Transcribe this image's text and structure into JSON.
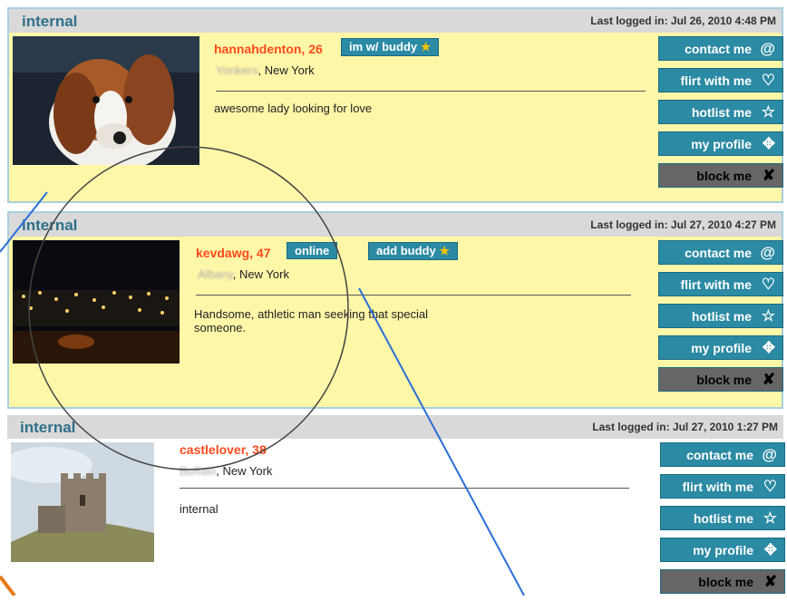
{
  "cards": [
    {
      "tag": "internal",
      "last_login": "Last logged in: Jul 26, 2010 4:48 PM",
      "name": "hannahdenton, 26",
      "location_hidden": "Yonkers",
      "location": ", New York",
      "description": "awesome lady looking for love",
      "badges": [
        {
          "label": "im w/ buddy",
          "icon": "star-icon"
        }
      ]
    },
    {
      "tag": "internal",
      "last_login": "Last logged in: Jul 27, 2010 4:27 PM",
      "name": "kevdawg, 47",
      "location_hidden": "Albany",
      "location": ", New York",
      "description": "Handsome, athletic man seeking that special someone.",
      "badges": [
        {
          "label": "online"
        },
        {
          "label": "add buddy",
          "icon": "star-icon"
        }
      ]
    },
    {
      "tag": "internal",
      "last_login": "Last logged in: Jul 27, 2010 1:27 PM",
      "name": "castlelover, 38",
      "location_hidden": "Buffalo",
      "location": ", New York",
      "description": "internal",
      "badges": []
    }
  ],
  "actions": [
    {
      "label": "contact me",
      "icon": "at-icon"
    },
    {
      "label": "flirt with me",
      "icon": "heart-icon"
    },
    {
      "label": "hotlist me",
      "icon": "star-outline-icon"
    },
    {
      "label": "my profile",
      "icon": "cross-arrows-icon"
    },
    {
      "label": "block me",
      "icon": "x-icon"
    }
  ],
  "colors": {
    "header_bg": "#d9d9d9",
    "highlight_bg": "#fff7a8",
    "accent": "#2b8aa4",
    "name": "#ff4a1c",
    "block": "#666666"
  }
}
